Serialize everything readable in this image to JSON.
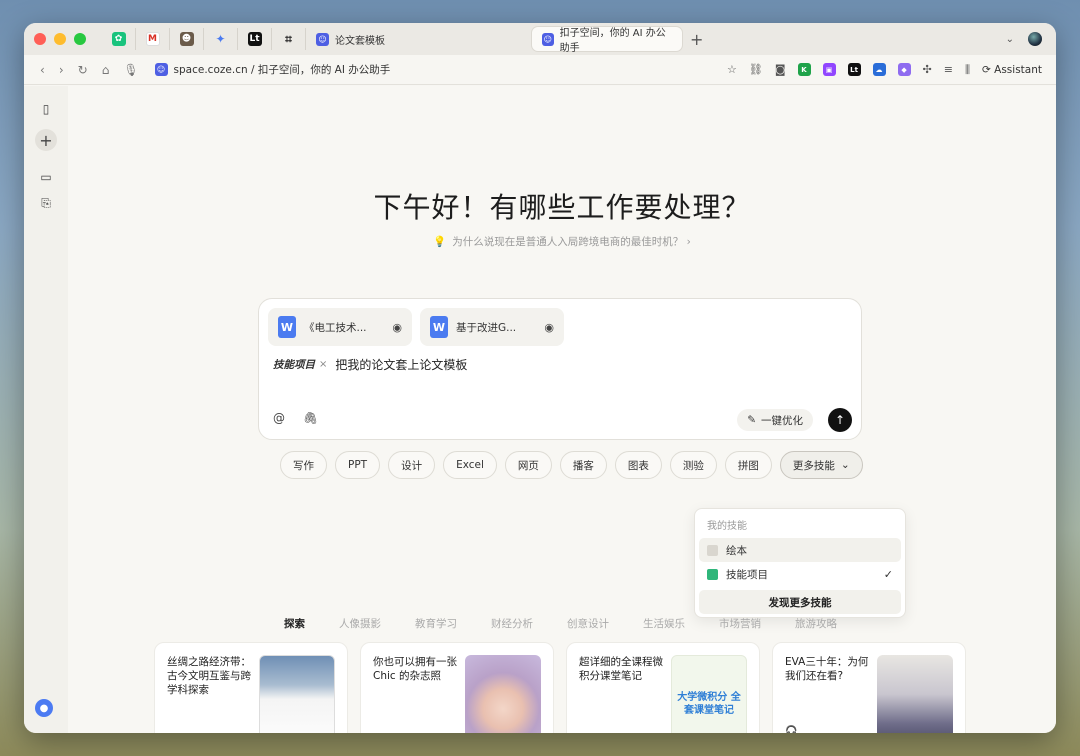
{
  "tabs": {
    "inactive_tab": "论文套模板",
    "active_tab": "扣子空间，你的 AI 办公助手",
    "new_tab_symbol": "+"
  },
  "address": {
    "url": "space.coze.cn / 扣子空间，你的 AI 办公助手",
    "assistant_label": "Assistant"
  },
  "main": {
    "greeting": "下午好！有哪些工作要处理？",
    "suggestion": "为什么说现在是普通人入局跨境电商的最佳时机？",
    "files": [
      {
        "name": "《电工技术..."
      },
      {
        "name": "基于改进G..."
      }
    ],
    "skill_tag": "技能项目",
    "prompt_text": "把我的论文套上论文模板",
    "optimize_label": "一键优化",
    "chips": [
      "写作",
      "PPT",
      "设计",
      "Excel",
      "网页",
      "播客",
      "图表",
      "测验",
      "拼图"
    ],
    "more_skills_label": "更多技能",
    "dropdown": {
      "header": "我的技能",
      "items": [
        {
          "label": "绘本"
        },
        {
          "label": "技能项目"
        }
      ],
      "discover_label": "发现更多技能"
    },
    "categories": [
      "探索",
      "人像摄影",
      "教育学习",
      "财经分析",
      "创意设计",
      "生活娱乐",
      "市场营销",
      "旅游攻略"
    ],
    "cards": [
      {
        "title": "丝绸之路经济带：古今文明互鉴与跨学科探索"
      },
      {
        "title": "你也可以拥有一张 Chic 的杂志照"
      },
      {
        "title": "超详细的全课程微积分课堂笔记",
        "image_text": "大学微积分 全套课堂笔记"
      },
      {
        "title": "EVA三十年：为何我们还在看?"
      }
    ]
  },
  "colors": {
    "accent_blue": "#4e5fe3",
    "send_button": "#111111"
  }
}
